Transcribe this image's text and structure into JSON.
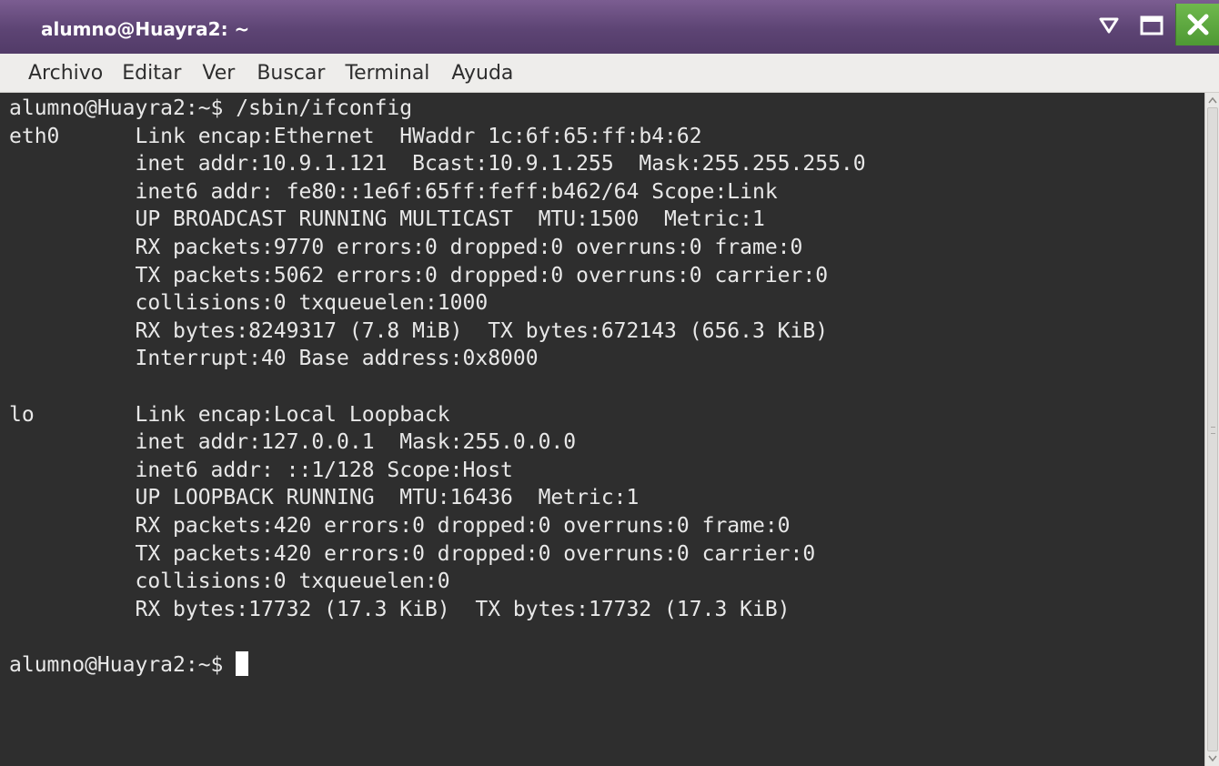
{
  "window": {
    "title": "alumno@Huayra2: ~"
  },
  "menu": {
    "items": [
      "Archivo",
      "Editar",
      "Ver",
      "Buscar",
      "Terminal",
      "Ayuda"
    ]
  },
  "terminal": {
    "lines": [
      "alumno@Huayra2:~$ /sbin/ifconfig",
      "eth0      Link encap:Ethernet  HWaddr 1c:6f:65:ff:b4:62  ",
      "          inet addr:10.9.1.121  Bcast:10.9.1.255  Mask:255.255.255.0",
      "          inet6 addr: fe80::1e6f:65ff:feff:b462/64 Scope:Link",
      "          UP BROADCAST RUNNING MULTICAST  MTU:1500  Metric:1",
      "          RX packets:9770 errors:0 dropped:0 overruns:0 frame:0",
      "          TX packets:5062 errors:0 dropped:0 overruns:0 carrier:0",
      "          collisions:0 txqueuelen:1000 ",
      "          RX bytes:8249317 (7.8 MiB)  TX bytes:672143 (656.3 KiB)",
      "          Interrupt:40 Base address:0x8000 ",
      "",
      "lo        Link encap:Local Loopback  ",
      "          inet addr:127.0.0.1  Mask:255.0.0.0",
      "          inet6 addr: ::1/128 Scope:Host",
      "          UP LOOPBACK RUNNING  MTU:16436  Metric:1",
      "          RX packets:420 errors:0 dropped:0 overruns:0 frame:0",
      "          TX packets:420 errors:0 dropped:0 overruns:0 carrier:0",
      "          collisions:0 txqueuelen:0 ",
      "          RX bytes:17732 (17.3 KiB)  TX bytes:17732 (17.3 KiB)",
      "",
      ""
    ],
    "prompt": "alumno@Huayra2:~$ "
  },
  "icons": {
    "minimize": "triangle-down-icon",
    "maximize": "square-icon",
    "close": "close-x-icon"
  },
  "colors": {
    "titlebar": "#5d4474",
    "terminal_bg": "#2e2e2e",
    "terminal_fg": "#e8e8e8",
    "close_button": "#5aa83d"
  }
}
